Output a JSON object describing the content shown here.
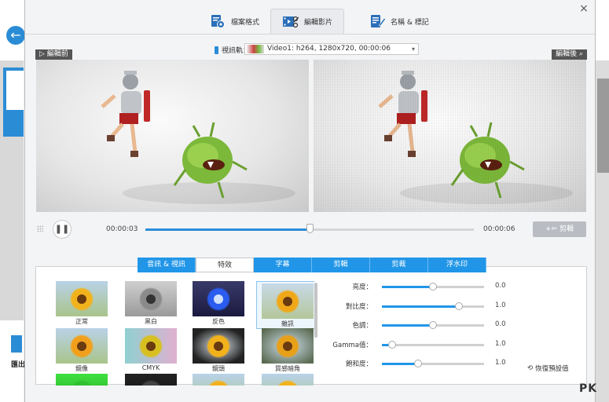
{
  "dialog": {
    "close_glyph": "×",
    "tabs": [
      {
        "label": "檔案格式",
        "icon": "file-gear-icon"
      },
      {
        "label": "編輯影片",
        "icon": "video-cut-icon"
      },
      {
        "label": "名稱 & 標記",
        "icon": "edit-doc-icon"
      }
    ]
  },
  "background_app": {
    "bottom_label": "匯出"
  },
  "preview": {
    "source_label": "視訊軌：",
    "source_value": "Video1: h264, 1280x720, 00:00:06",
    "before_label": "▷ 編輯前",
    "after_label": "編輯後 ⌕"
  },
  "playback": {
    "current_time": "00:00:03",
    "total_time": "00:00:06",
    "progress": 0.5,
    "pause_glyph": "❚❚",
    "clip_label": "剪輯"
  },
  "edit_tabs": [
    "音訊 & 視訊",
    "特效",
    "字幕",
    "剪輯",
    "剪裁",
    "浮水印"
  ],
  "active_edit_tab": 1,
  "effects": [
    {
      "label": "正常",
      "style": "normal"
    },
    {
      "label": "黑白",
      "style": "bw"
    },
    {
      "label": "反色",
      "style": "invert"
    },
    {
      "label": "雜訊",
      "style": "noise",
      "selected": true
    },
    {
      "label": "鏡像",
      "style": "mirror"
    },
    {
      "label": "CMYK",
      "style": "cmyk"
    },
    {
      "label": "鏡頭",
      "style": "lens"
    },
    {
      "label": "質感暗角",
      "style": "vignette"
    },
    {
      "label": "",
      "style": "green"
    },
    {
      "label": "",
      "style": "dark"
    },
    {
      "label": "",
      "style": "normal"
    },
    {
      "label": "",
      "style": "normal"
    }
  ],
  "adjustments": [
    {
      "label": "亮度：",
      "value": "0.0",
      "fraction": 0.5
    },
    {
      "label": "對比度：",
      "value": "1.0",
      "fraction": 0.75
    },
    {
      "label": "色調：",
      "value": "0.0",
      "fraction": 0.5
    },
    {
      "label": "Gamma值：",
      "value": "1.0",
      "fraction": 0.1
    },
    {
      "label": "飽和度：",
      "value": "1.0",
      "fraction": 0.35
    }
  ],
  "restore_label": "恢復預設值",
  "watermark": "PK",
  "colors": {
    "accent": "#2196e8",
    "tab_active": "#ffffff"
  }
}
